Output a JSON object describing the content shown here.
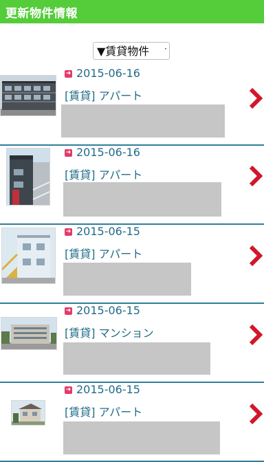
{
  "header": {
    "title": "更新物件情報"
  },
  "filter": {
    "selected": "▼賃貸物件"
  },
  "listings": [
    {
      "date": "2015-06-16",
      "type": "[賃貸] アパート"
    },
    {
      "date": "2015-06-16",
      "type": "[賃貸] アパート"
    },
    {
      "date": "2015-06-15",
      "type": "[賃貸] アパート"
    },
    {
      "date": "2015-06-15",
      "type": "[賃貸] マンション"
    },
    {
      "date": "2015-06-15",
      "type": "[賃貸] アパート"
    }
  ],
  "icons": {
    "date": "new-arrow-icon",
    "next": "chevron-right-icon"
  },
  "colors": {
    "header": "#55cc3a",
    "text": "#1f6b86",
    "chevron": "#d0182a",
    "badge": "#e23b69"
  }
}
